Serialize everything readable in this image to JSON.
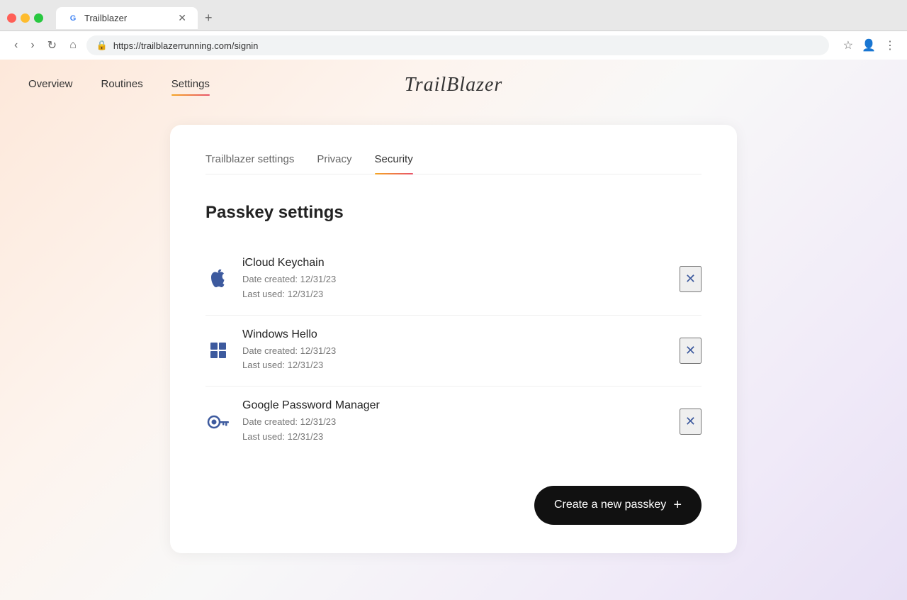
{
  "browser": {
    "tab_title": "Trailblazer",
    "url": "https://trailblazerrunning.com/signin",
    "new_tab_label": "+"
  },
  "nav": {
    "links": [
      {
        "id": "overview",
        "label": "Overview",
        "active": false
      },
      {
        "id": "routines",
        "label": "Routines",
        "active": false
      },
      {
        "id": "settings",
        "label": "Settings",
        "active": true
      }
    ],
    "logo": "TrailBlazer"
  },
  "settings": {
    "tabs": [
      {
        "id": "trailblazer-settings",
        "label": "Trailblazer settings",
        "active": false
      },
      {
        "id": "privacy",
        "label": "Privacy",
        "active": false
      },
      {
        "id": "security",
        "label": "Security",
        "active": true
      }
    ],
    "section_title": "Passkey settings",
    "passkeys": [
      {
        "id": "icloud",
        "name": "iCloud Keychain",
        "date_created": "Date created: 12/31/23",
        "last_used": "Last used: 12/31/23",
        "icon_type": "apple"
      },
      {
        "id": "windows-hello",
        "name": "Windows Hello",
        "date_created": "Date created: 12/31/23",
        "last_used": "Last used: 12/31/23",
        "icon_type": "windows"
      },
      {
        "id": "google-pm",
        "name": "Google Password Manager",
        "date_created": "Date created: 12/31/23",
        "last_used": "Last used: 12/31/23",
        "icon_type": "key"
      }
    ],
    "create_button_label": "Create a new passkey"
  }
}
